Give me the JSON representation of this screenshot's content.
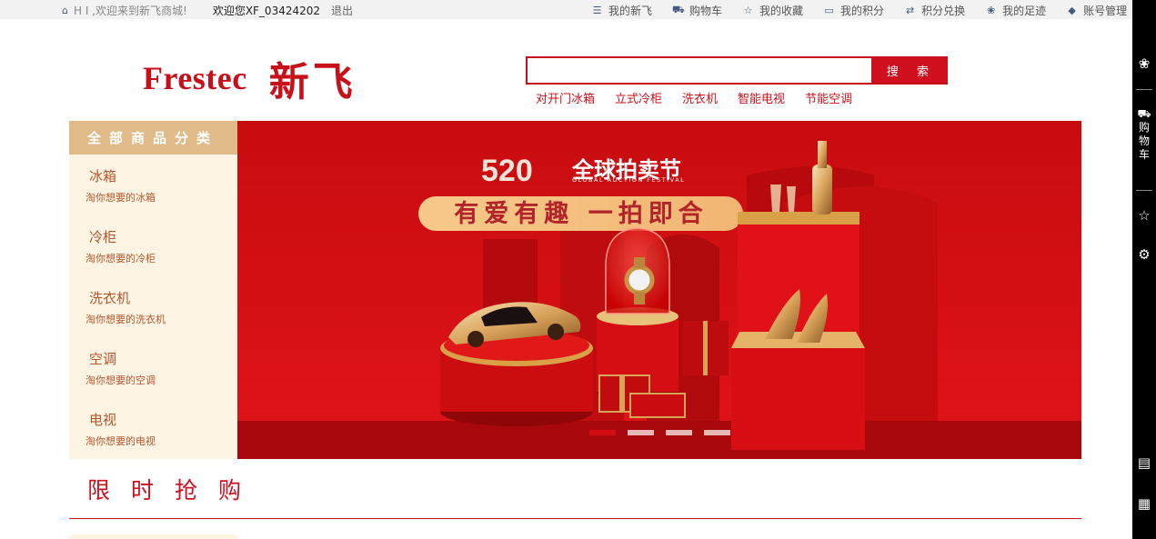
{
  "topbar": {
    "welcome": "H I ,欢迎来到新飞商城!",
    "user": "欢迎您XF_03424202",
    "logout": "退出",
    "links": [
      {
        "icon": "list-icon",
        "glyph": "☰",
        "label": "我的新飞"
      },
      {
        "icon": "cart-icon",
        "glyph": "⛟",
        "label": "购物车"
      },
      {
        "icon": "star-icon",
        "glyph": "☆",
        "label": "我的收藏"
      },
      {
        "icon": "monitor-icon",
        "glyph": "▭",
        "label": "我的积分"
      },
      {
        "icon": "exchange-icon",
        "glyph": "⇄",
        "label": "积分兑换"
      },
      {
        "icon": "paw-icon",
        "glyph": "❀",
        "label": "我的足迹"
      },
      {
        "icon": "tag-icon",
        "glyph": "◆",
        "label": "账号管理"
      }
    ]
  },
  "logo": {
    "en": "Frestec",
    "cn": "新飞"
  },
  "search": {
    "value": "",
    "placeholder": "",
    "button": "搜 索"
  },
  "hot_links": [
    "对开门冰箱",
    "立式冷柜",
    "洗衣机",
    "智能电视",
    "节能空调"
  ],
  "categories": {
    "title": "全部商品分类",
    "items": [
      {
        "name": "冰箱",
        "desc": "淘你想要的冰箱"
      },
      {
        "name": "冷柜",
        "desc": "淘你想要的冷柜"
      },
      {
        "name": "洗衣机",
        "desc": "淘你想要的洗衣机"
      },
      {
        "name": "空调",
        "desc": "淘你想要的空调"
      },
      {
        "name": "电视",
        "desc": "淘你想要的电视"
      }
    ]
  },
  "banner": {
    "event_number": "520",
    "event_title": "全球拍卖节",
    "event_subtitle": "GLOBAL AUCTION FESTIVAL",
    "slogan": "有爱有趣 一拍即合",
    "slides": 4,
    "active_slide": 1
  },
  "flash_sale": {
    "title": "限时抢购"
  },
  "toolbar": {
    "items": [
      {
        "icon": "paw-icon",
        "glyph": "❀"
      },
      {
        "icon": "cart-icon",
        "glyph": "⛟",
        "label": "购物车"
      },
      {
        "icon": "star-icon",
        "glyph": "☆"
      },
      {
        "icon": "settings-icon",
        "glyph": "⚙"
      },
      {
        "icon": "document-icon",
        "glyph": "▤"
      },
      {
        "icon": "qrcode-icon",
        "glyph": "▦"
      }
    ]
  },
  "colors": {
    "brand": "#c8101a",
    "category_header": "#e0bb89",
    "category_bg": "#fdf4e3",
    "toolbar": "#000000"
  }
}
